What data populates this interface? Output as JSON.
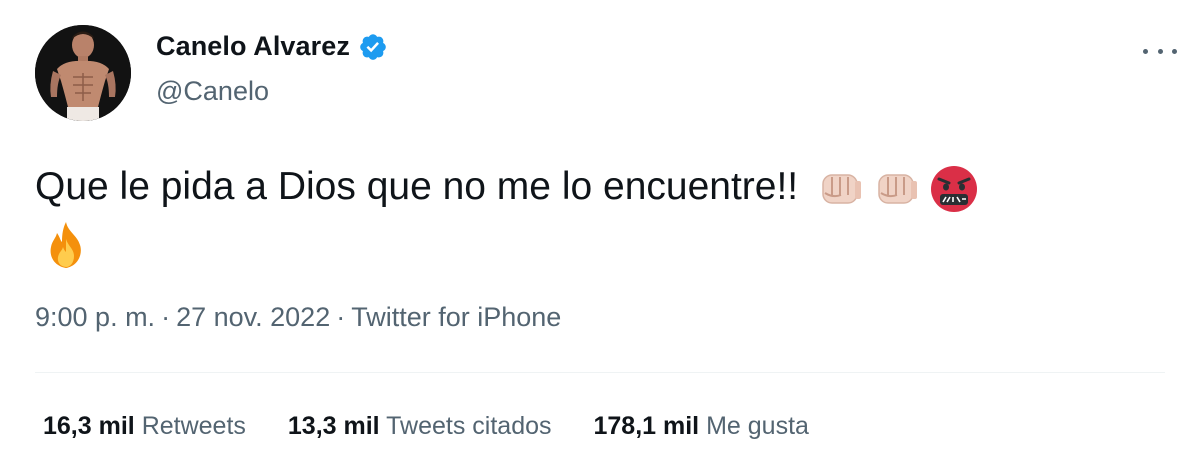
{
  "author": {
    "display_name": "Canelo Alvarez",
    "handle": "@Canelo",
    "verified": true
  },
  "tweet": {
    "text": "Que le pida a Dios que no me lo encuentre!!",
    "emojis": [
      "oncoming-fist",
      "oncoming-fist",
      "face-with-symbols-on-mouth",
      "fire"
    ],
    "time": "9:00 p. m.",
    "date": "27 nov. 2022",
    "source": "Twitter for iPhone",
    "separator": "·"
  },
  "stats": {
    "retweets": {
      "count": "16,3 mil",
      "label": "Retweets"
    },
    "quotes": {
      "count": "13,3 mil",
      "label": "Tweets citados"
    },
    "likes": {
      "count": "178,1 mil",
      "label": "Me gusta"
    }
  },
  "colors": {
    "text": "#0f1419",
    "secondary": "#536471",
    "verified": "#1d9bf0",
    "divider": "#eff3f4"
  }
}
